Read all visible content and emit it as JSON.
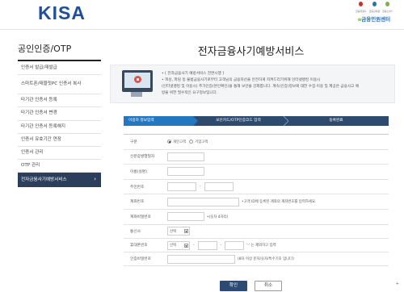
{
  "header": {
    "logo": "KISA",
    "brand_name_1": "e",
    "brand_name_2": "금융민원센터",
    "brand_marks": [
      {
        "label": "금융위원회",
        "color": "#c9302c"
      },
      {
        "label": "금융감독원",
        "color": "#2b6fb5"
      },
      {
        "label": "금융소비자",
        "color": "#7cb342"
      }
    ]
  },
  "sidebar": {
    "title": "공인인증/OTP",
    "items": [
      "인증서 발급/재발급",
      "스마트폰/태블릿PC 인증서 복사",
      "타기관 인증서 등록",
      "타기관 인증서 변경",
      "타기관 인증서 등록해지",
      "인증서 유효기간 연장",
      "인증서 관리",
      "OTP 관리",
      "전자금융사기예방서비스"
    ]
  },
  "main": {
    "title": "전자금융사기예방서비스",
    "notice": [
      "• [ 전자금융사기 예방서비스 전면시행 ]",
      "• 피싱, 파밍 등 불법금융사기로부터 고객님의 금융자산을 안전하게 지켜드리기위해 인터넷뱅킹 이용시",
      "(인터넷뱅킹 및 이용시) 추가인증(본인확인)을 통해 보안을 강화합니다. 계속(인증)정보에 대한 수집·이용 및 제공은 금융사고 예",
      "방을 위한 필수적인 요구정보입니다."
    ],
    "steps": [
      "이용자 정보입력",
      "보안카드/OTP인증코드 입력",
      "등록완료"
    ]
  },
  "form": {
    "type_label": "구분",
    "type_options": [
      "개인고객",
      "기업고객"
    ],
    "biz_label": "신분증발행일자",
    "name_label": "이름(실명)",
    "rrn_label": "주민번호",
    "account_label": "계좌번호",
    "account_hint": "•고객 ID에 등록된 계좌의 계좌번호를 입력하세요.",
    "account_pw_label": "계좌비밀번호",
    "account_pw_hint": "•(숫자 4자리)",
    "carrier_label": "통신사",
    "carrier_value": "선택",
    "phone_label": "휴대폰번호",
    "phone_prefix": "선택",
    "phone_hint": "'-' 는 제외하고 입력",
    "pin_label": "인증비밀번호",
    "pin_hint": "(8자 이상 문자/숫자/특수기호 입니다)"
  },
  "buttons": {
    "confirm": "확인",
    "cancel": "취소"
  },
  "corner_mark": "+"
}
